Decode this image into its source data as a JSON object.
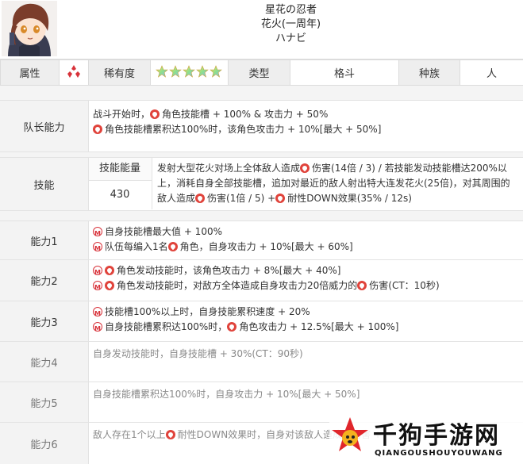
{
  "header": {
    "name_line1": "星花の忍者",
    "name_line2": "花火(一周年)",
    "name_line3": "ハナビ"
  },
  "attr_row": {
    "attribute_label": "属性",
    "attribute_icon": "red-diamond-attribute-icon",
    "rarity_label": "稀有度",
    "rarity_stars": 5,
    "type_label": "类型",
    "type_value": "格斗",
    "race_label": "种族",
    "race_value": "人"
  },
  "leader": {
    "label": "队长能力",
    "line1": "战斗开始时，",
    "line1b": "角色技能槽 + 100% & 攻击力 + 50%",
    "line2": "角色技能槽累积达100%时，该角色攻击力 + 10%[最大 + 50%]"
  },
  "skill": {
    "label": "技能",
    "energy_header": "技能能量",
    "energy_value": "430",
    "t1": "发射大型花火对场上全体敌人造成",
    "t2": "伤害(14倍 / 3) / 若技能发动技能槽达200%以上，消耗自身全部技能槽，追加对最近的敌人射出特大连发花火(25倍)，对其周围的敌人造成",
    "t3": "伤害(1倍 / 5) +",
    "t4": "耐性DOWN效果(35% / 12s)"
  },
  "abilities": [
    {
      "label": "能力1",
      "lines": [
        "自身技能槽最大值 + 100%",
        "队伍每编入1名",
        "角色，自身攻击力 + 10%[最大 + 60%]"
      ]
    },
    {
      "label": "能力2",
      "lines": [
        "角色发动技能时，该角色攻击力 + 8%[最大 + 40%]",
        "角色发动技能时，对敌方全体造成自身攻击力20倍威力的",
        "伤害(CT：10秒)"
      ]
    },
    {
      "label": "能力3",
      "lines": [
        "技能槽100%以上时，自身技能累积速度 + 20%",
        "自身技能槽累积达100%时，",
        "角色攻击力 + 12.5%[最大 + 100%]"
      ]
    },
    {
      "label": "能力4",
      "lines": [
        "自身发动技能时，自身技能槽 + 30%(CT：90秒)"
      ]
    },
    {
      "label": "能力5",
      "lines": [
        "自身技能槽累积达100%时，自身攻击力 + 10%[最大 + 50%]"
      ]
    },
    {
      "label": "能力6",
      "lines": [
        "敌人存在1个以上",
        "耐性DOWN效果时，自身对该敌人造成的伤害 +"
      ]
    }
  ],
  "watermark": {
    "title": "千狗手游网",
    "subtitle": "QIANGOUSHOUYOUWANG"
  },
  "colors": {
    "accent_red": "#e0433b",
    "label_bg": "#f3f3f3",
    "border": "#dcdcdc"
  }
}
